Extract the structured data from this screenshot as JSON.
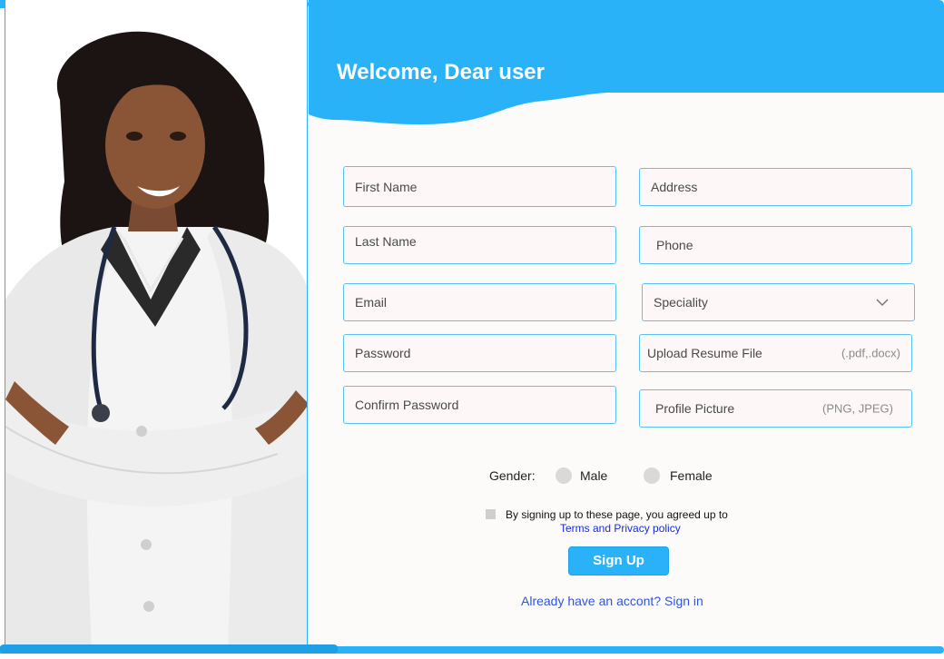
{
  "header": {
    "title": "Welcome, Dear user"
  },
  "fields": {
    "first_name": "First Name",
    "last_name": "Last Name",
    "email": "Email",
    "password": "Password",
    "confirm_password": "Confirm Password",
    "address": "Address",
    "phone": "Phone",
    "speciality": "Speciality",
    "upload_resume": {
      "label": "Upload Resume File",
      "hint": "(.pdf,.docx)"
    },
    "profile_picture": {
      "label": "Profile Picture",
      "hint": "(PNG, JPEG)"
    }
  },
  "gender": {
    "label": "Gender:",
    "options": [
      "Male",
      "Female"
    ]
  },
  "terms": {
    "text": "By signing up to these page, you agreed up to",
    "link": "Terms and Privacy policy"
  },
  "signup_label": "Sign Up",
  "signin_link": "Already have an accont? Sign in",
  "colors": {
    "accent": "#29b2f8",
    "form_bg": "#fcfbfa",
    "field_bg": "#fdf7f7",
    "link": "#2d55e0"
  }
}
